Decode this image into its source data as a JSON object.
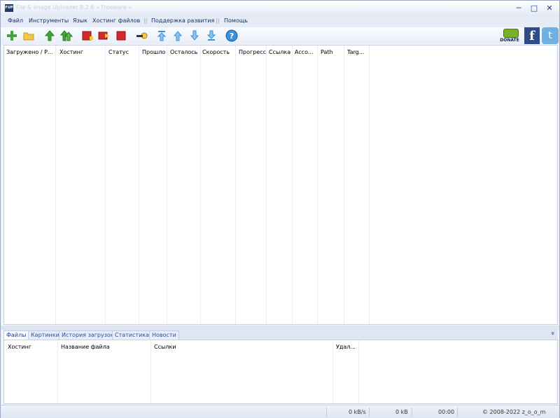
{
  "window": {
    "title": "File & Image Uploader 8.2.6  « Freeware »",
    "app_icon_text": "FUP",
    "minimize": "─",
    "maximize": "□",
    "close": "✕"
  },
  "menu": [
    "Файл",
    "Инструменты",
    "Язык",
    "Хостинг файлов",
    "Поддержка развития",
    "Помощь"
  ],
  "toolbar": {
    "icons": [
      "add-icon",
      "folder-icon",
      "upload-icon",
      "upload-all-icon",
      "stop-icon",
      "skip-icon",
      "stop-all-icon",
      "key-icon",
      "move-top-icon",
      "move-up-icon",
      "move-down-icon",
      "move-bottom-icon",
      "help-icon"
    ],
    "donate_label": "DONATE",
    "facebook_glyph": "f",
    "twitter_glyph": "t",
    "colors": {
      "green": "#3fa63a",
      "yellow": "#f4c844",
      "red": "#d62a2a",
      "blue": "#3a90d8"
    }
  },
  "upload_table": {
    "columns": [
      "Загружено / Р...",
      "Хостинг",
      "Статус",
      "Прошло",
      "Осталось",
      "Скорость",
      "Прогресс",
      "Ссылка",
      "Acco...",
      "Path",
      "Targ..."
    ],
    "rows": []
  },
  "tabs": [
    "Файлы",
    "Картинки",
    "История загрузок",
    "Статистика",
    "Новости"
  ],
  "collapse_glyph": "»",
  "files_table": {
    "columns": [
      "Хостинг",
      "Название файла",
      "Ссылки",
      "Удал..."
    ],
    "rows": []
  },
  "status": {
    "speed": "0 kB/s",
    "size": "0 kB",
    "time": "00:00",
    "copyright": "© 2008-2022 z_o_o_m"
  }
}
